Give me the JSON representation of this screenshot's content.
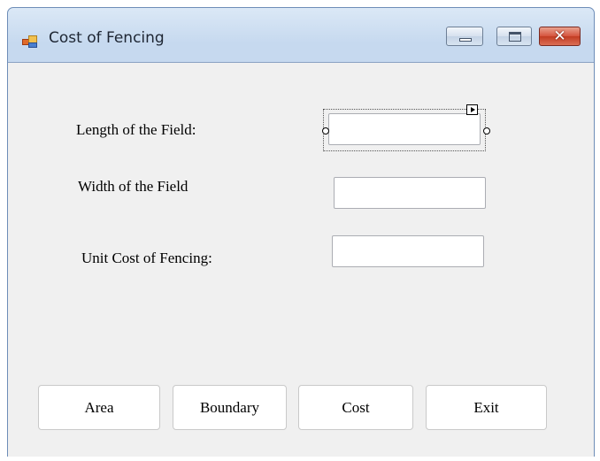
{
  "window": {
    "title": "Cost of Fencing",
    "close_glyph": "✕"
  },
  "icons": {
    "app": "windows-form-icon",
    "minimize": "minimize-icon",
    "maximize": "maximize-icon",
    "close": "close-icon"
  },
  "form": {
    "length_label": "Length of the Field:",
    "length_value": "",
    "width_label": "Width of the Field",
    "width_value": "",
    "unit_cost_label": "Unit Cost of Fencing:",
    "unit_cost_value": ""
  },
  "buttons": {
    "area": "Area",
    "boundary": "Boundary",
    "cost": "Cost",
    "exit": "Exit"
  },
  "colors": {
    "client_background": "#f0f0f0",
    "titlebar": "#c6d9ef",
    "close_button": "#c23c22"
  }
}
